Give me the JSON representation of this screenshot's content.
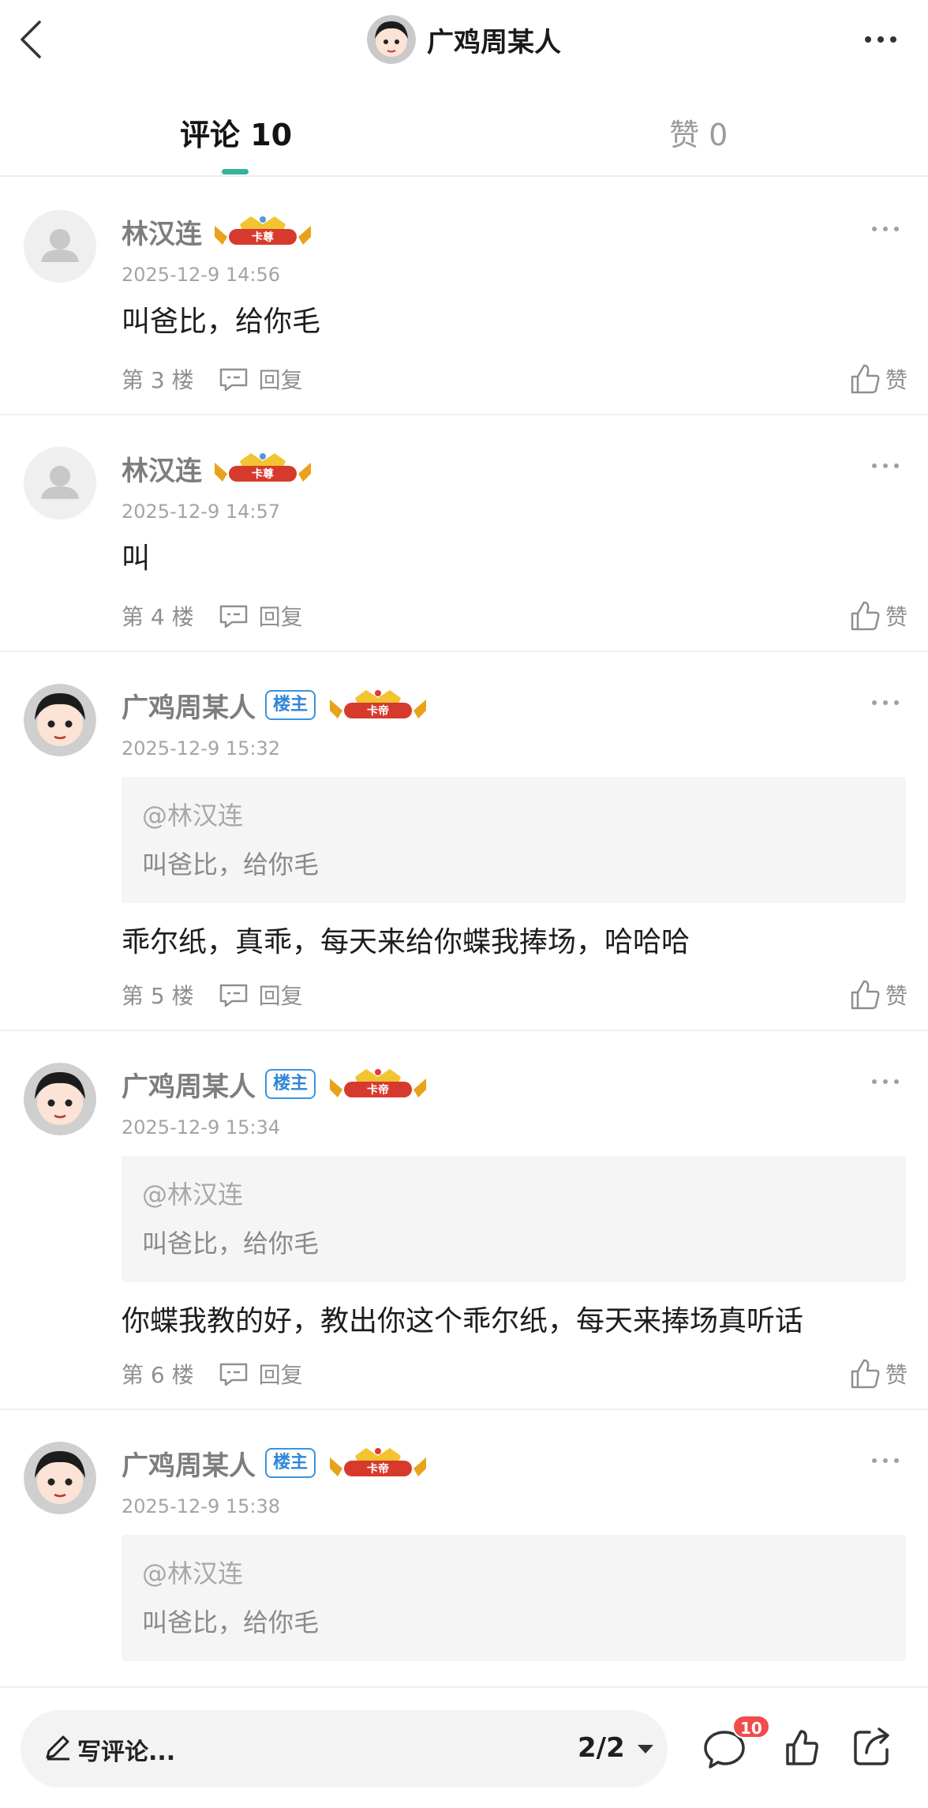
{
  "header": {
    "title": "广鸡周某人"
  },
  "tabs": {
    "comments_label": "评论 10",
    "likes_label": "赞 0"
  },
  "common": {
    "reply_label": "回复",
    "like_label": "赞",
    "owner_badge": "楼主",
    "quote_at": "@林汉连",
    "crown_zun": "卡尊",
    "crown_di": "卡帝"
  },
  "comments": [
    {
      "name": "林汉连",
      "time": "2025-12-9 14:56",
      "text": "叫爸比，给你毛",
      "floor": "第 3 楼"
    },
    {
      "name": "林汉连",
      "time": "2025-12-9 14:57",
      "text": "叫",
      "floor": "第 4 楼"
    },
    {
      "name": "广鸡周某人",
      "time": "2025-12-9 15:32",
      "quote": "叫爸比，给你毛",
      "text": "乖尔纸，真乖，每天来给你蝶我捧场，哈哈哈",
      "floor": "第 5 楼"
    },
    {
      "name": "广鸡周某人",
      "time": "2025-12-9 15:34",
      "quote": "叫爸比，给你毛",
      "text": "你蝶我教的好，教出你这个乖尔纸，每天来捧场真听话",
      "floor": "第 6 楼"
    },
    {
      "name": "广鸡周某人",
      "time": "2025-12-9 15:38",
      "quote": "叫爸比，给你毛"
    }
  ],
  "bottom": {
    "placeholder": "写评论...",
    "page_indicator": "2/2",
    "comment_count": "10"
  },
  "colors": {
    "accent": "#36b39a",
    "owner_badge": "#2f86d6",
    "notification": "#f04c4c"
  }
}
